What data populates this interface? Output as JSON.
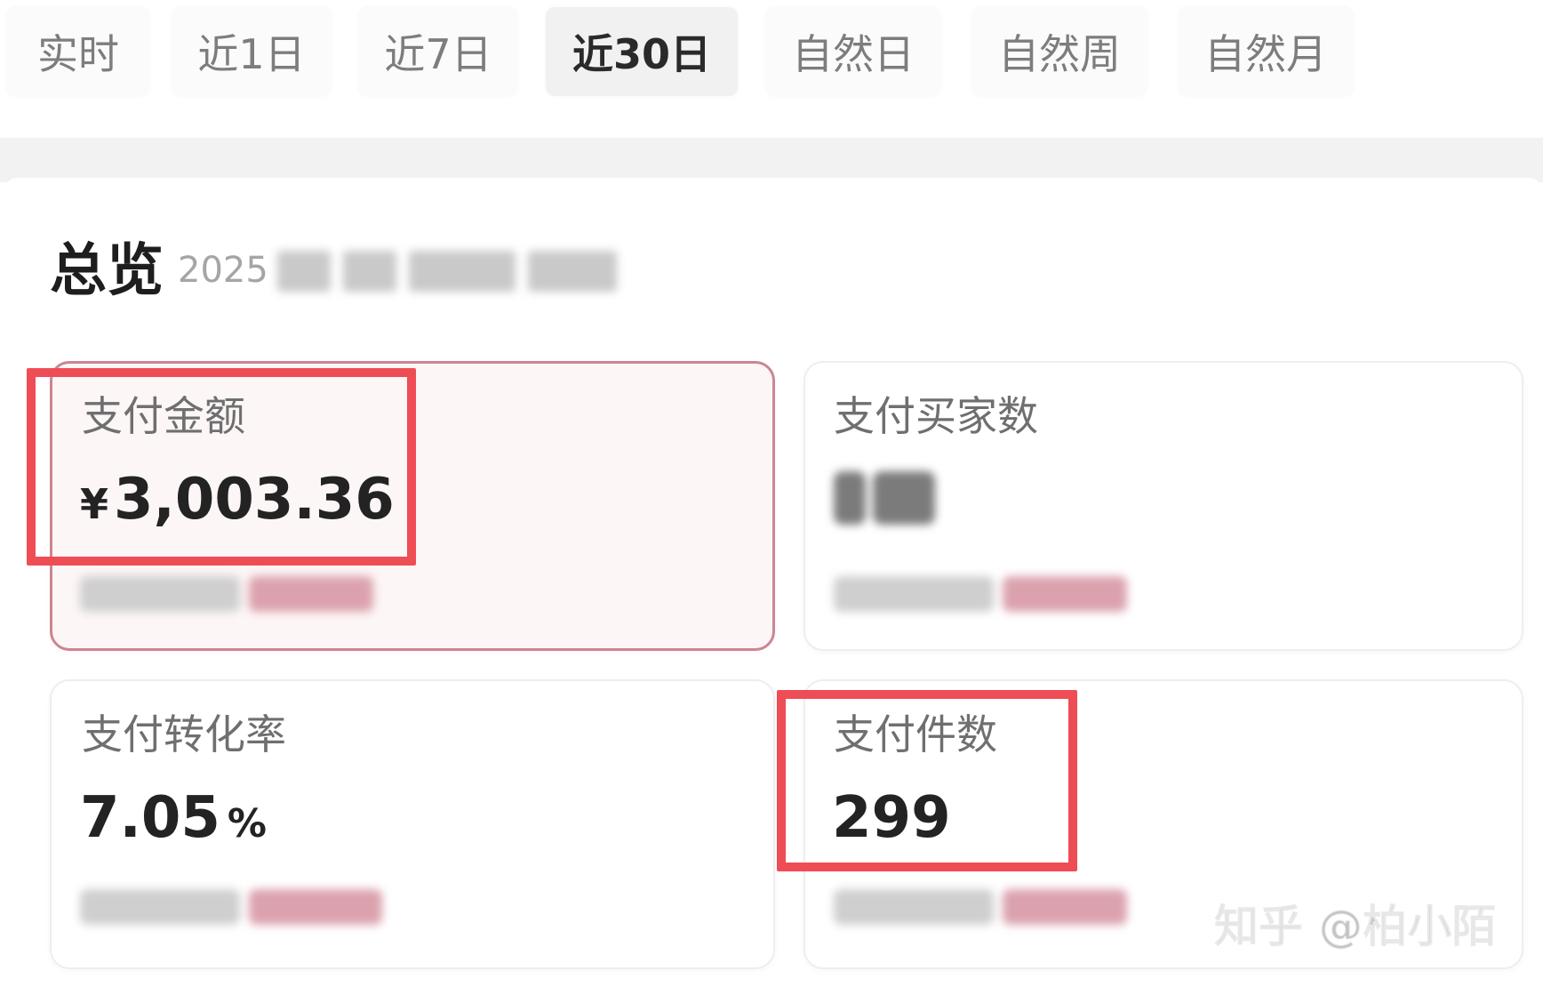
{
  "tabs": [
    {
      "label": "实时",
      "active": false
    },
    {
      "label": "近1日",
      "active": false
    },
    {
      "label": "近7日",
      "active": false
    },
    {
      "label": "近30日",
      "active": true
    },
    {
      "label": "自然日",
      "active": false
    },
    {
      "label": "自然周",
      "active": false
    },
    {
      "label": "自然月",
      "active": false
    }
  ],
  "overview": {
    "title": "总览",
    "date_prefix": "2025"
  },
  "metrics": {
    "pay_amount": {
      "label": "支付金额",
      "currency": "¥",
      "value": "3,003.36"
    },
    "pay_buyers": {
      "label": "支付买家数"
    },
    "conversion_rate": {
      "label": "支付转化率",
      "value": "7.05",
      "unit": "%"
    },
    "pay_items": {
      "label": "支付件数",
      "value": "299"
    }
  },
  "watermark": "知乎 @柏小陌",
  "colors": {
    "annotation_red": "#ef4d55",
    "highlight_border": "#cc8592",
    "highlight_bg": "#fdf6f6"
  }
}
